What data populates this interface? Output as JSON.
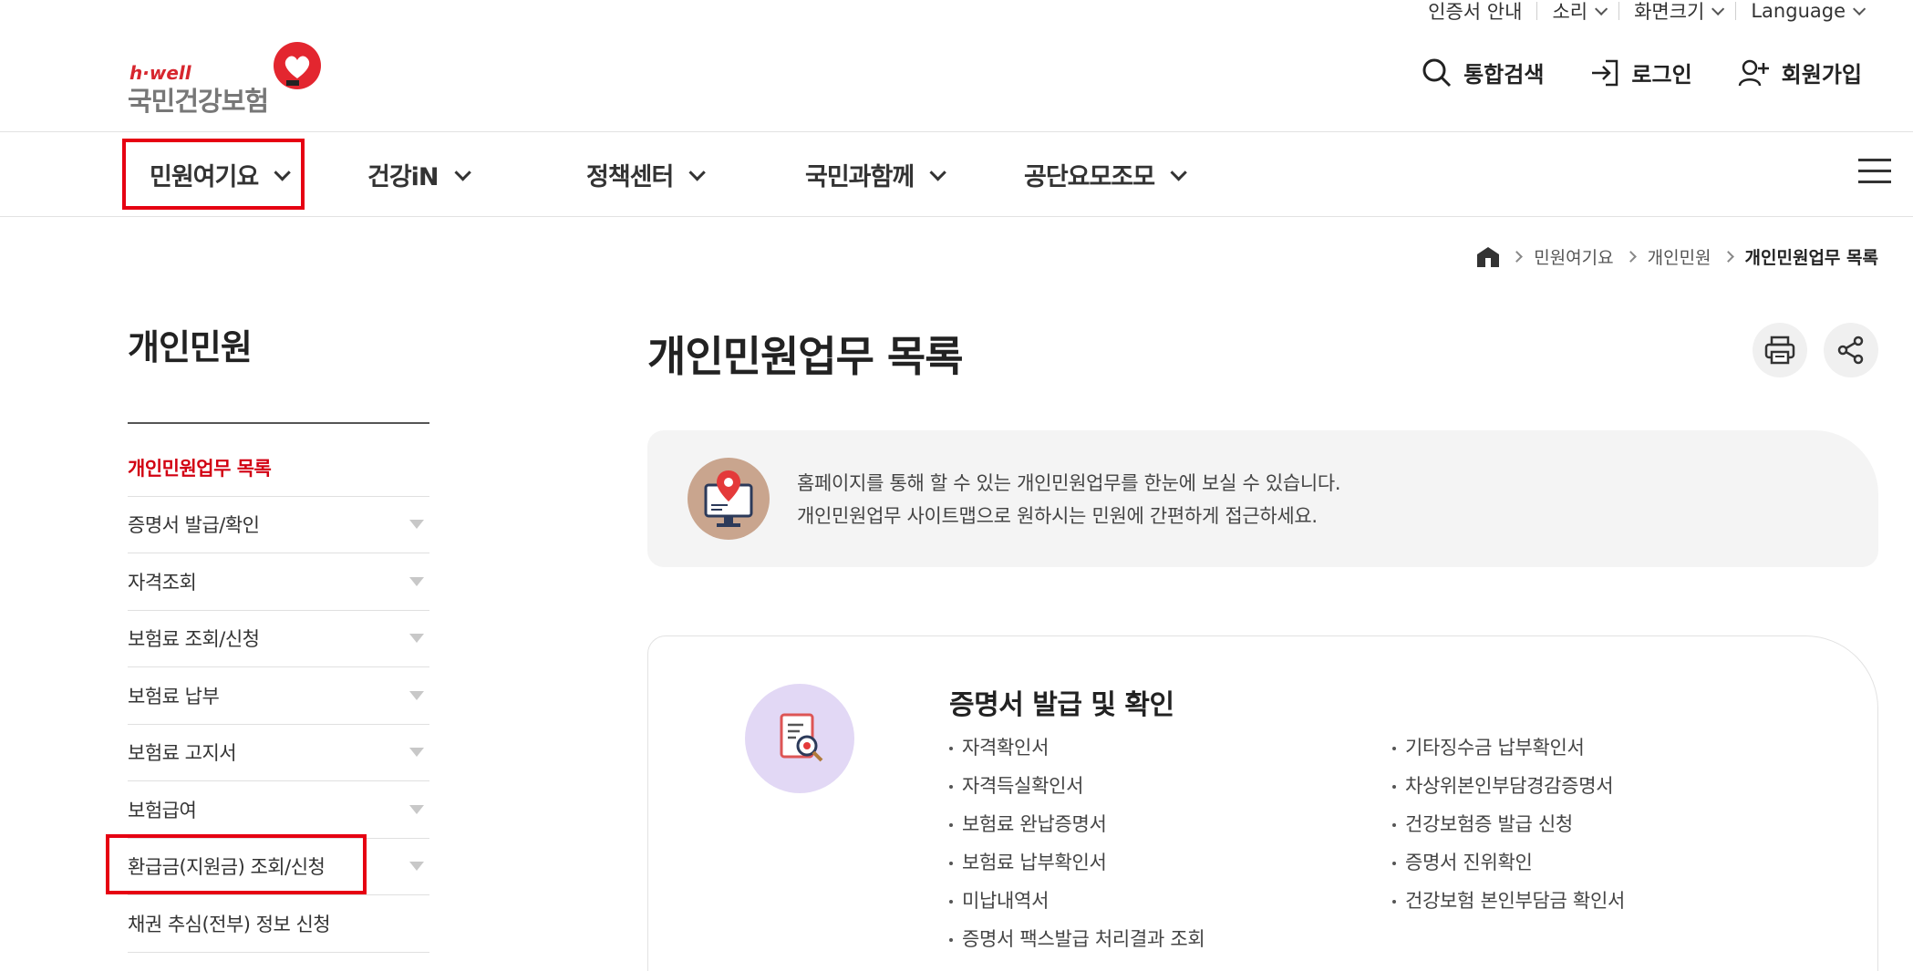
{
  "utility": {
    "cert_guide": "인증서 안내",
    "sound": "소리",
    "screen_size": "화면크기",
    "language": "Language"
  },
  "logo": {
    "english": "h·well",
    "korean": "국민건강보험",
    "brand_color": "#d7262e"
  },
  "top_actions": {
    "search": "통합검색",
    "login": "로그인",
    "signup": "회원가입"
  },
  "gnb": {
    "items": [
      {
        "label": "민원여기요"
      },
      {
        "label": "건강iN"
      },
      {
        "label": "정책센터"
      },
      {
        "label": "국민과함께"
      },
      {
        "label": "공단요모조모"
      }
    ]
  },
  "breadcrumb": {
    "items": [
      "민원여기요",
      "개인민원",
      "개인민원업무 목록"
    ]
  },
  "sidebar": {
    "title": "개인민원",
    "items": [
      {
        "label": "개인민원업무 목록"
      },
      {
        "label": "증명서 발급/확인"
      },
      {
        "label": "자격조회"
      },
      {
        "label": "보험료 조회/신청"
      },
      {
        "label": "보험료 납부"
      },
      {
        "label": "보험료 고지서"
      },
      {
        "label": "보험급여"
      },
      {
        "label": "환급금(지원금) 조회/신청"
      },
      {
        "label": "채권 추심(전부) 정보 신청"
      }
    ]
  },
  "main": {
    "title": "개인민원업무 목록",
    "intro": {
      "line1": "홈페이지를 통해 할 수 있는 개인민원업무를 한눈에 보실 수 있습니다.",
      "line2": "개인민원업무 사이트맵으로 원하시는 민원에 간편하게 접근하세요."
    },
    "section": {
      "title": "증명서 발급 및 확인",
      "left": [
        "자격확인서",
        "자격득실확인서",
        "보험료 완납증명서",
        "보험료 납부확인서",
        "미납내역서",
        "증명서 팩스발급 처리결과 조회"
      ],
      "right": [
        "기타징수금 납부확인서",
        "차상위본인부담경감증명서",
        "건강보험증 발급 신청",
        "증명서 진위확인",
        "건강보험 본인부담금 확인서"
      ]
    }
  },
  "colors": {
    "accent_red": "#d20012",
    "highlight_box": "#e60012"
  }
}
